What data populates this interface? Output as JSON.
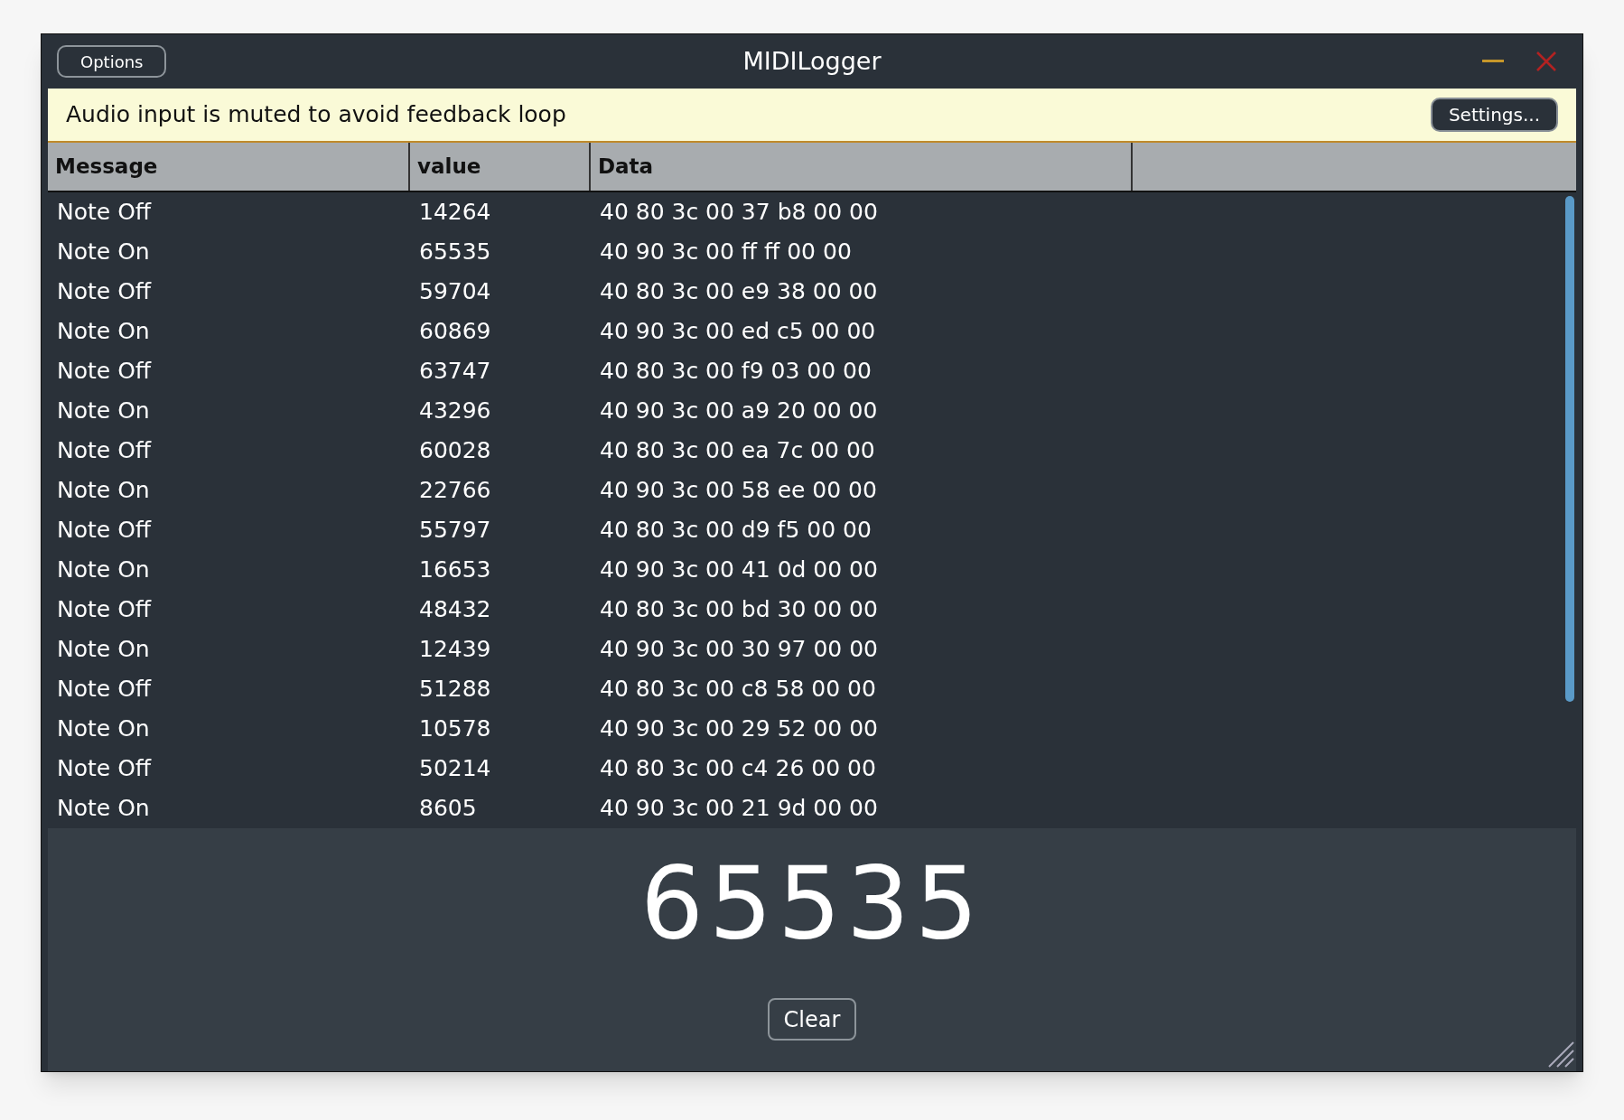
{
  "window": {
    "title": "MIDILogger",
    "options_button": "Options"
  },
  "banner": {
    "message": "Audio input is muted to avoid feedback loop",
    "button": "Settings..."
  },
  "table": {
    "columns": [
      "Message",
      "value",
      "Data"
    ],
    "rows": [
      [
        "Note Off",
        "14264",
        "40 80 3c 00 37 b8 00 00"
      ],
      [
        "Note On",
        "65535",
        "40 90 3c 00 ff ff 00 00"
      ],
      [
        "Note Off",
        "59704",
        "40 80 3c 00 e9 38 00 00"
      ],
      [
        "Note On",
        "60869",
        "40 90 3c 00 ed c5 00 00"
      ],
      [
        "Note Off",
        "63747",
        "40 80 3c 00 f9 03 00 00"
      ],
      [
        "Note On",
        "43296",
        "40 90 3c 00 a9 20 00 00"
      ],
      [
        "Note Off",
        "60028",
        "40 80 3c 00 ea 7c 00 00"
      ],
      [
        "Note On",
        "22766",
        "40 90 3c 00 58 ee 00 00"
      ],
      [
        "Note Off",
        "55797",
        "40 80 3c 00 d9 f5 00 00"
      ],
      [
        "Note On",
        "16653",
        "40 90 3c 00 41 0d 00 00"
      ],
      [
        "Note Off",
        "48432",
        "40 80 3c 00 bd 30 00 00"
      ],
      [
        "Note On",
        "12439",
        "40 90 3c 00 30 97 00 00"
      ],
      [
        "Note Off",
        "51288",
        "40 80 3c 00 c8 58 00 00"
      ],
      [
        "Note On",
        "10578",
        "40 90 3c 00 29 52 00 00"
      ],
      [
        "Note Off",
        "50214",
        "40 80 3c 00 c4 26 00 00"
      ],
      [
        "Note On",
        "8605",
        "40 90 3c 00 21 9d 00 00"
      ]
    ]
  },
  "display": {
    "value": "65535",
    "button": "Clear"
  }
}
